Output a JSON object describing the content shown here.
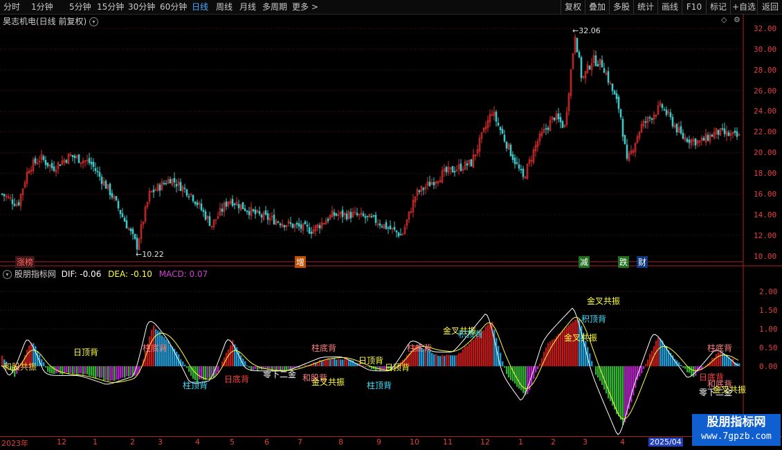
{
  "toolbar": {
    "left": [
      "分时",
      "1分钟",
      "5分钟",
      "15分钟",
      "30分钟",
      "60分钟",
      "日线",
      "周线",
      "月线",
      "多周期",
      "更多 >"
    ],
    "active": "日线",
    "right": [
      "复权",
      "叠加",
      "多股",
      "统计",
      "画线",
      "F10",
      "标记",
      "+自选",
      "返回"
    ]
  },
  "price_panel": {
    "title": "昊志机电(日线 前复权)",
    "y_ticks": [
      "32.00",
      "30.00",
      "28.00",
      "26.00",
      "24.00",
      "22.00",
      "20.00",
      "18.00",
      "16.00",
      "14.00",
      "12.00",
      "10.00"
    ],
    "high_label": "32.06",
    "low_label": "10.22",
    "event_tags": [
      {
        "text": "涨榜",
        "color": "#ff6060",
        "bg": "#402020"
      },
      {
        "text": "增",
        "color": "#ffffff",
        "bg": "#c05000"
      },
      {
        "text": "减",
        "color": "#ffffff",
        "bg": "#207020"
      },
      {
        "text": "跌",
        "color": "#ffffff",
        "bg": "#207020"
      },
      {
        "text": "财",
        "color": "#ffffff",
        "bg": "#103880"
      }
    ]
  },
  "indicator_panel": {
    "name": "股朋指标网",
    "dif_label": "DIF: -0.06",
    "dea_label": "DEA: -0.10",
    "macd_label": "MACD: 0.07",
    "y_ticks": [
      "2.00",
      "1.50",
      "1.00",
      "0.50",
      "0.00"
    ],
    "annotations": [
      {
        "text": "和股共振",
        "color": "#ffd040"
      },
      {
        "text": "日顶背",
        "color": "#ffff40"
      },
      {
        "text": "柱底背",
        "color": "#ff8080"
      },
      {
        "text": "柱顶背",
        "color": "#40e0ff"
      },
      {
        "text": "日底背",
        "color": "#ff4040"
      },
      {
        "text": "零下二金",
        "color": "#ffffff"
      },
      {
        "text": "和股背",
        "color": "#ff8080"
      },
      {
        "text": "金叉共振",
        "color": "#ffff40"
      },
      {
        "text": "柱底背",
        "color": "#ff8080"
      },
      {
        "text": "日顶背",
        "color": "#ffff40"
      },
      {
        "text": "日顶背",
        "color": "#ffff40"
      },
      {
        "text": "柱顶背",
        "color": "#40e0ff"
      },
      {
        "text": "柱底背",
        "color": "#ff8080"
      },
      {
        "text": "金叉共振",
        "color": "#ffff40"
      },
      {
        "text": "积顶背",
        "color": "#40e0ff"
      },
      {
        "text": "金叉共振",
        "color": "#ffff40"
      },
      {
        "text": "金叉共振",
        "color": "#ffff40"
      },
      {
        "text": "积顶背",
        "color": "#40e0ff"
      },
      {
        "text": "柱底背",
        "color": "#ff8080"
      },
      {
        "text": "日底背",
        "color": "#ff4040"
      },
      {
        "text": "和底背",
        "color": "#ff8080"
      },
      {
        "text": "零下二金",
        "color": "#ffffff"
      },
      {
        "text": "金叉共振",
        "color": "#ffff40"
      }
    ]
  },
  "date_axis": [
    "2023年",
    "12",
    "1",
    "2",
    "3",
    "4",
    "5",
    "6",
    "7",
    "8",
    "9",
    "10",
    "11",
    "12",
    "1",
    "2",
    "3",
    "4",
    "2025/04"
  ],
  "watermark": {
    "title": "股朋指标网",
    "url": "www.7gpzb.com"
  },
  "colors": {
    "up": "#e03030",
    "down": "#40c8c8",
    "dif": "#ffffff",
    "dea": "#ffff40",
    "macd_up": "#c01818",
    "macd_up2": "#1a9ad0",
    "macd_dn": "#30b030",
    "macd_dn2": "#b020c0",
    "axis": "#e04040",
    "grid": "#5a1a1a"
  }
}
